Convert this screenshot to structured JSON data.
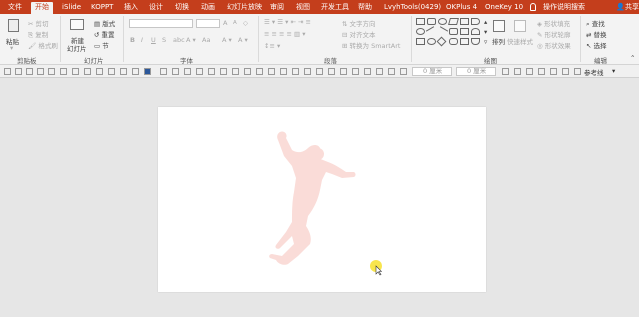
{
  "tabs": [
    {
      "label": "文件",
      "active": false
    },
    {
      "label": "开始",
      "active": true
    },
    {
      "label": "iSlide",
      "active": false
    },
    {
      "label": "KOPPT",
      "active": false
    },
    {
      "label": "插入",
      "active": false
    },
    {
      "label": "设计",
      "active": false
    },
    {
      "label": "切换",
      "active": false
    },
    {
      "label": "动画",
      "active": false
    },
    {
      "label": "幻灯片放映",
      "active": false
    },
    {
      "label": "审阅",
      "active": false
    },
    {
      "label": "视图",
      "active": false
    },
    {
      "label": "开发工具",
      "active": false
    },
    {
      "label": "帮助",
      "active": false
    },
    {
      "label": "LvyhTools(0429)",
      "active": false
    },
    {
      "label": "OKPlus 4",
      "active": false
    },
    {
      "label": "OneKey 10",
      "active": false
    }
  ],
  "tell_me": "操作说明搜索",
  "user": "共享",
  "colors": {
    "title_bar": "#c43e1c",
    "ribbon_bg": "#f3f3f3",
    "canvas_bg": "#e6e6e6",
    "silhouette": "#fadcd8",
    "cursor_highlight": "#f7e23a"
  },
  "ribbon": {
    "clipboard": {
      "paste": "粘贴",
      "cut": "剪切",
      "copy": "复制",
      "format_painter": "格式刷",
      "group": "剪贴板"
    },
    "slides": {
      "new_slide": "新建",
      "new_slide_2": "幻灯片",
      "layout": "版式",
      "reset": "重置",
      "section": "节",
      "group": "幻灯片"
    },
    "font": {
      "bold": "B",
      "italic": "I",
      "underline": "U",
      "strike": "S",
      "spacing": "abc",
      "aa": "Aa",
      "grow": "A",
      "shrink": "A",
      "group": "字体"
    },
    "paragraph": {
      "text_direction": "文字方向",
      "align_text": "对齐文本",
      "smartart": "转换为 SmartArt",
      "group": "段落"
    },
    "drawing": {
      "arrange": "排列",
      "quick_styles": "快速样式",
      "shape_fill": "形状填充",
      "shape_outline": "形状轮廓",
      "shape_effects": "形状效果",
      "group": "绘图"
    },
    "editing": {
      "find": "查找",
      "replace": "替换",
      "select": "选择",
      "group": "编辑"
    }
  },
  "toolbar2": {
    "width_placeholder": "0 厘米",
    "height_placeholder": "0 厘米",
    "reference_line": "参考线"
  }
}
